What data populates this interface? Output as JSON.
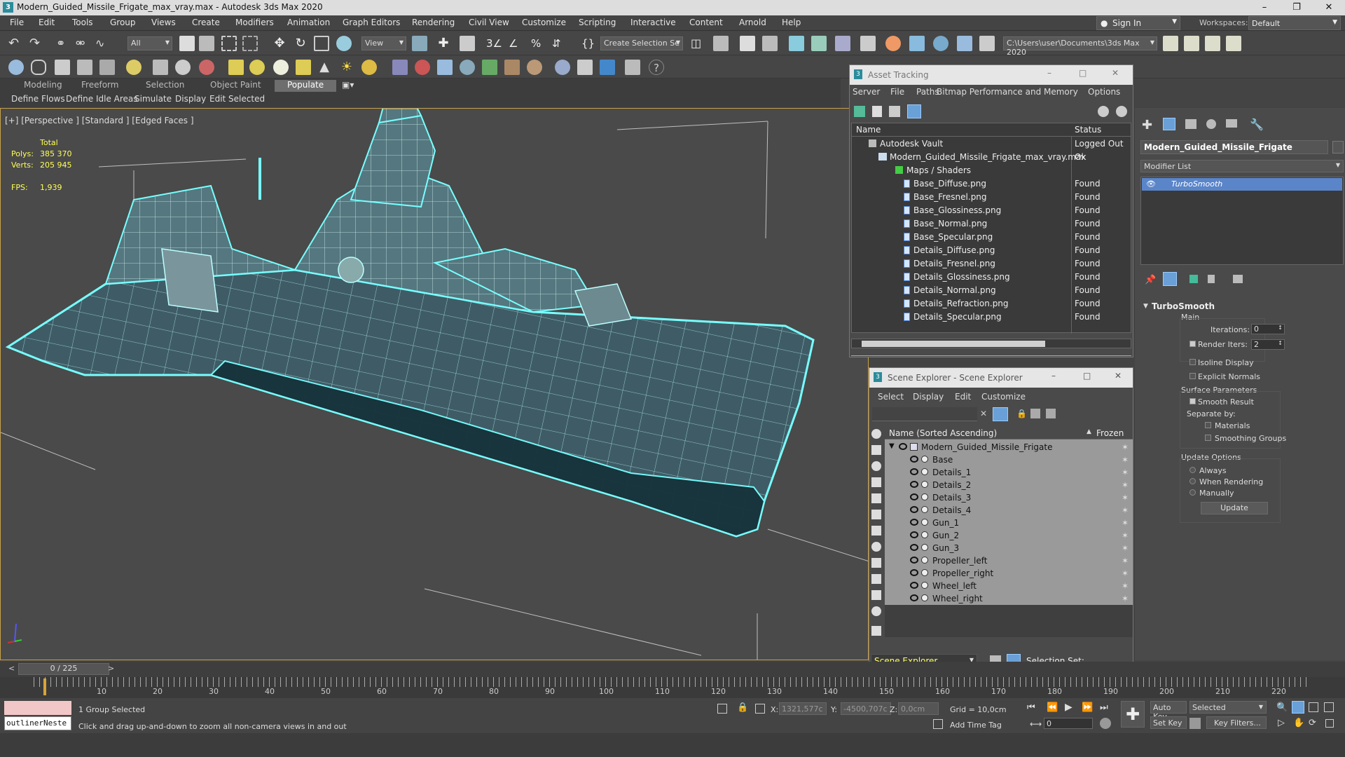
{
  "window": {
    "title": "Modern_Guided_Missile_Frigate_max_vray.max - Autodesk 3ds Max 2020"
  },
  "menu": [
    "File",
    "Edit",
    "Tools",
    "Group",
    "Views",
    "Create",
    "Modifiers",
    "Animation",
    "Graph Editors",
    "Rendering",
    "Civil View",
    "Customize",
    "Scripting",
    "Interactive",
    "Content",
    "Arnold",
    "Help"
  ],
  "account": {
    "sign_in": "Sign In",
    "workspaces_label": "Workspaces:",
    "workspace": "Default"
  },
  "toolbar": {
    "filter_all": "All",
    "view": "View",
    "create_selection_set": "Create Selection Se",
    "project_path": "C:\\Users\\user\\Documents\\3ds Max 2020"
  },
  "ribbon": {
    "tabs": [
      "Modeling",
      "Freeform",
      "Selection",
      "Object Paint",
      "Populate"
    ],
    "active_tab": "Populate",
    "subtabs": [
      "Define Flows",
      "Define Idle Areas",
      "Simulate",
      "Display",
      "Edit Selected"
    ]
  },
  "viewport": {
    "label": "[+] [Perspective ] [Standard ] [Edged Faces ]",
    "stats": {
      "total_label": "Total",
      "polys_label": "Polys:",
      "polys": "385 370",
      "verts_label": "Verts:",
      "verts": "205 945",
      "fps_label": "FPS:",
      "fps": "1,939"
    },
    "accent": "#7fffff"
  },
  "asset_tracking": {
    "title": "Asset Tracking",
    "menu": [
      "Server",
      "File",
      "Paths",
      "Bitmap Performance and Memory",
      "Options"
    ],
    "columns": {
      "name": "Name",
      "status": "Status"
    },
    "vault": {
      "name": "Autodesk Vault",
      "status": "Logged Out ..."
    },
    "scene_file": {
      "name": "Modern_Guided_Missile_Frigate_max_vray.max",
      "status": "Ok"
    },
    "maps_folder": "Maps / Shaders",
    "files": [
      {
        "name": "Base_Diffuse.png",
        "status": "Found"
      },
      {
        "name": "Base_Fresnel.png",
        "status": "Found"
      },
      {
        "name": "Base_Glossiness.png",
        "status": "Found"
      },
      {
        "name": "Base_Normal.png",
        "status": "Found"
      },
      {
        "name": "Base_Specular.png",
        "status": "Found"
      },
      {
        "name": "Details_Diffuse.png",
        "status": "Found"
      },
      {
        "name": "Details_Fresnel.png",
        "status": "Found"
      },
      {
        "name": "Details_Glossiness.png",
        "status": "Found"
      },
      {
        "name": "Details_Normal.png",
        "status": "Found"
      },
      {
        "name": "Details_Refraction.png",
        "status": "Found"
      },
      {
        "name": "Details_Specular.png",
        "status": "Found"
      }
    ]
  },
  "scene_explorer": {
    "title": "Scene Explorer - Scene Explorer",
    "menu": [
      "Select",
      "Display",
      "Edit",
      "Customize"
    ],
    "col_name": "Name (Sorted Ascending)",
    "col_frozen": "Frozen",
    "root": "Modern_Guided_Missile_Frigate",
    "children": [
      "Base",
      "Details_1",
      "Details_2",
      "Details_3",
      "Details_4",
      "Gun_1",
      "Gun_2",
      "Gun_3",
      "Propeller_left",
      "Propeller_right",
      "Wheel_left",
      "Wheel_right"
    ],
    "footer_dropdown": "Scene Explorer",
    "selection_set_label": "Selection Set:"
  },
  "command_panel": {
    "object_name": "Modern_Guided_Missile_Frigate",
    "modifier_list": "Modifier List",
    "modifier": "TurboSmooth",
    "rollout_title": "TurboSmooth",
    "main_label": "Main",
    "iterations_label": "Iterations:",
    "iterations": "0",
    "render_iters_label": "Render Iters:",
    "render_iters": "2",
    "isoline": "Isoline Display",
    "explicit_normals": "Explicit Normals",
    "surface_params": "Surface Parameters",
    "smooth_result": "Smooth Result",
    "separate_by": "Separate by:",
    "materials": "Materials",
    "smoothing_groups": "Smoothing Groups",
    "update_options": "Update Options",
    "always": "Always",
    "when_rendering": "When Rendering",
    "manually": "Manually",
    "update_button": "Update"
  },
  "timeline": {
    "frame": "0 / 225",
    "ticks": [
      "10",
      "20",
      "30",
      "40",
      "50",
      "60",
      "70",
      "80",
      "90",
      "100",
      "110",
      "120",
      "130",
      "140",
      "150",
      "160",
      "170",
      "180",
      "190",
      "200",
      "210",
      "220"
    ]
  },
  "status": {
    "script_box": "outlinerNeste",
    "selected": "1 Group Selected",
    "prompt": "Click and drag up-and-down to zoom all non-camera views in and out",
    "x_label": "X:",
    "x": "1321,577c",
    "y_label": "Y:",
    "y": "-4500,707c",
    "z_label": "Z:",
    "z": "0,0cm",
    "grid": "Grid = 10,0cm",
    "add_time_tag": "Add Time Tag",
    "auto_key": "Auto Key",
    "set_key": "Set Key",
    "selected_dropdown": "Selected",
    "key_filters": "Key Filters...",
    "frame_field": "0"
  }
}
